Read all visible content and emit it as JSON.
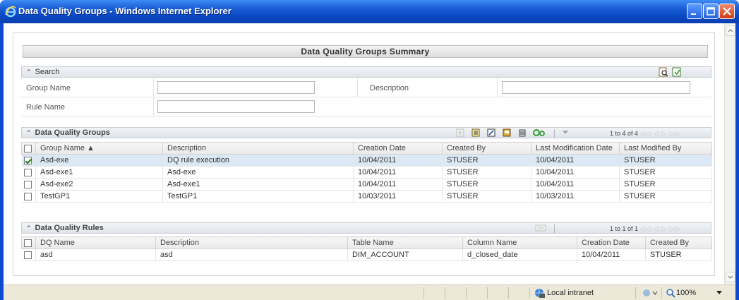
{
  "window": {
    "title": "Data Quality Groups - Windows Internet Explorer"
  },
  "summary": {
    "title": "Data Quality Groups Summary"
  },
  "search": {
    "header": "Search",
    "fields": {
      "group_name_label": "Group Name",
      "group_name_value": "",
      "description_label": "Description",
      "description_value": "",
      "rule_name_label": "Rule Name",
      "rule_name_value": ""
    }
  },
  "groups": {
    "header": "Data Quality Groups",
    "pager": "1 to 4 of 4",
    "columns": [
      "Group Name ▲",
      "Description",
      "Creation Date",
      "Created By",
      "Last Modification Date",
      "Last Modified By"
    ],
    "rows": [
      {
        "checked": true,
        "cells": [
          "Asd-exe",
          "DQ rule execution",
          "10/04/2011",
          "STUSER",
          "10/04/2011",
          "STUSER"
        ]
      },
      {
        "checked": false,
        "cells": [
          "Asd-exe1",
          "Asd-exe",
          "10/04/2011",
          "STUSER",
          "10/04/2011",
          "STUSER"
        ]
      },
      {
        "checked": false,
        "cells": [
          "Asd-exe2",
          "Asd-exe1",
          "10/04/2011",
          "STUSER",
          "10/04/2011",
          "STUSER"
        ]
      },
      {
        "checked": false,
        "cells": [
          "TestGP1",
          "TestGP1",
          "10/03/2011",
          "STUSER",
          "10/03/2011",
          "STUSER"
        ]
      }
    ]
  },
  "rules": {
    "header": "Data Quality Rules",
    "pager": "1 to 1 of 1",
    "columns": [
      "DQ Name",
      "Description",
      "Table Name",
      "Column Name",
      "Creation Date",
      "Created By"
    ],
    "rows": [
      {
        "checked": false,
        "cells": [
          "asd",
          "asd",
          "DIM_ACCOUNT",
          "d_closed_date",
          "10/04/2011",
          "STUSER"
        ]
      }
    ]
  },
  "statusbar": {
    "zone": "Local intranet",
    "zoom": "100%"
  },
  "colors": {
    "titlebar": "#0a48c4",
    "selected_row": "#dce9f5",
    "section_header": "#dfe4ea"
  }
}
